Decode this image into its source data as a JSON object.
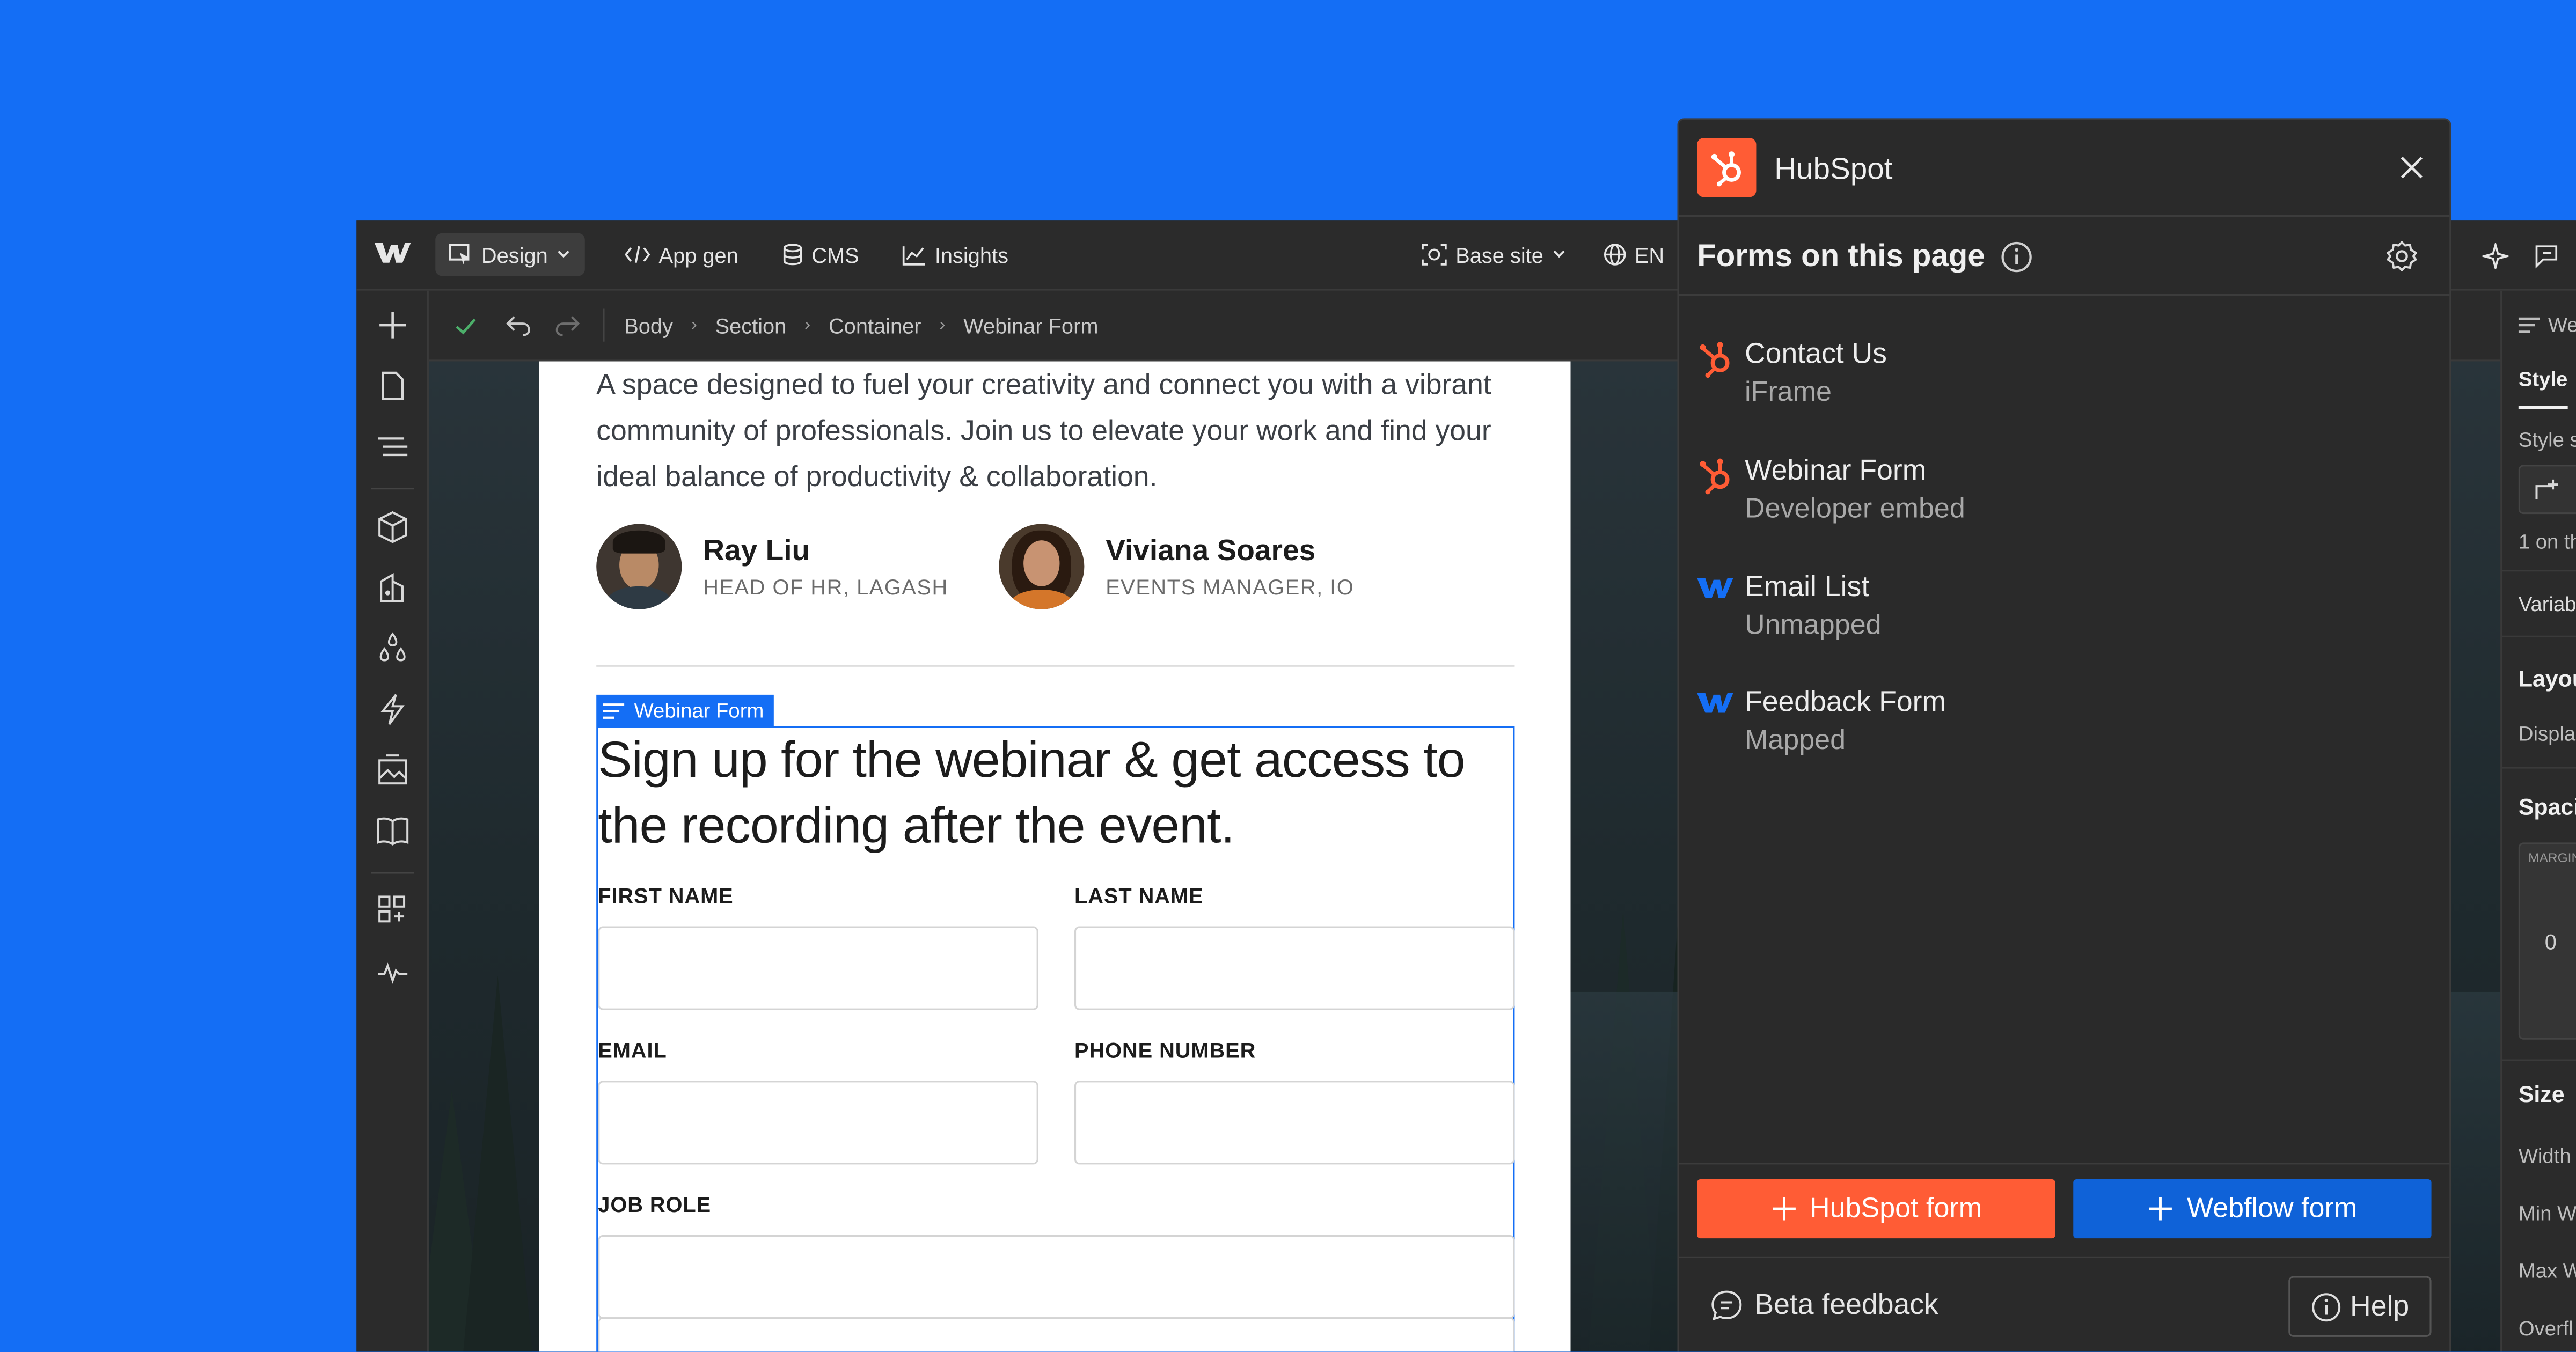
{
  "toolbar": {
    "design_label": "Design",
    "appgen_label": "App gen",
    "cms_label": "CMS",
    "insights_label": "Insights",
    "basesite_label": "Base site",
    "lang_label": "EN"
  },
  "breadcrumb": [
    "Body",
    "Section",
    "Container",
    "Webinar Form"
  ],
  "canvas": {
    "intro_text": "A space designed to fuel your creativity and connect you with a vibrant community of professionals. Join us to elevate your work and find your ideal balance of productivity & collaboration.",
    "speakers": [
      {
        "name": "Ray Liu",
        "role": "HEAD OF HR, LAGASH"
      },
      {
        "name": "Viviana Soares",
        "role": "EVENTS MANAGER, IO"
      }
    ],
    "selection_tag": "Webinar Form",
    "form_title": "Sign up for the webinar & get access to the recording after the event.",
    "fields": {
      "first_name": "FIRST NAME",
      "last_name": "LAST NAME",
      "email": "EMAIL",
      "phone": "PHONE NUMBER",
      "job_role": "JOB ROLE"
    }
  },
  "right_panel": {
    "tab_partial": "We",
    "style_tab": "Style",
    "style_selector_partial": "Style s",
    "count_partial": "1 on th",
    "variables_partial": "Variab",
    "layout_partial": "Layou",
    "display_partial": "Displa",
    "spacing_partial": "Spaci",
    "margin_label": "MARGIN",
    "margin_value": "0",
    "size_label": "Size",
    "width_partial": "Width",
    "minw_partial": "Min W",
    "maxw_partial": "Max W",
    "overflow_partial": "Overfl"
  },
  "hubspot": {
    "title": "HubSpot",
    "subtitle": "Forms on this page",
    "forms": [
      {
        "name": "Contact Us",
        "sub": "iFrame",
        "source": "hubspot"
      },
      {
        "name": "Webinar Form",
        "sub": "Developer embed",
        "source": "hubspot"
      },
      {
        "name": "Email List",
        "sub": "Unmapped",
        "source": "webflow"
      },
      {
        "name": "Feedback Form",
        "sub": "Mapped",
        "source": "webflow"
      }
    ],
    "hubspot_button": "HubSpot form",
    "webflow_button": "Webflow form",
    "beta_feedback": "Beta feedback",
    "help": "Help",
    "colors": {
      "hubspot_orange": "#FF5C35",
      "webflow_blue": "#146EF5"
    }
  }
}
